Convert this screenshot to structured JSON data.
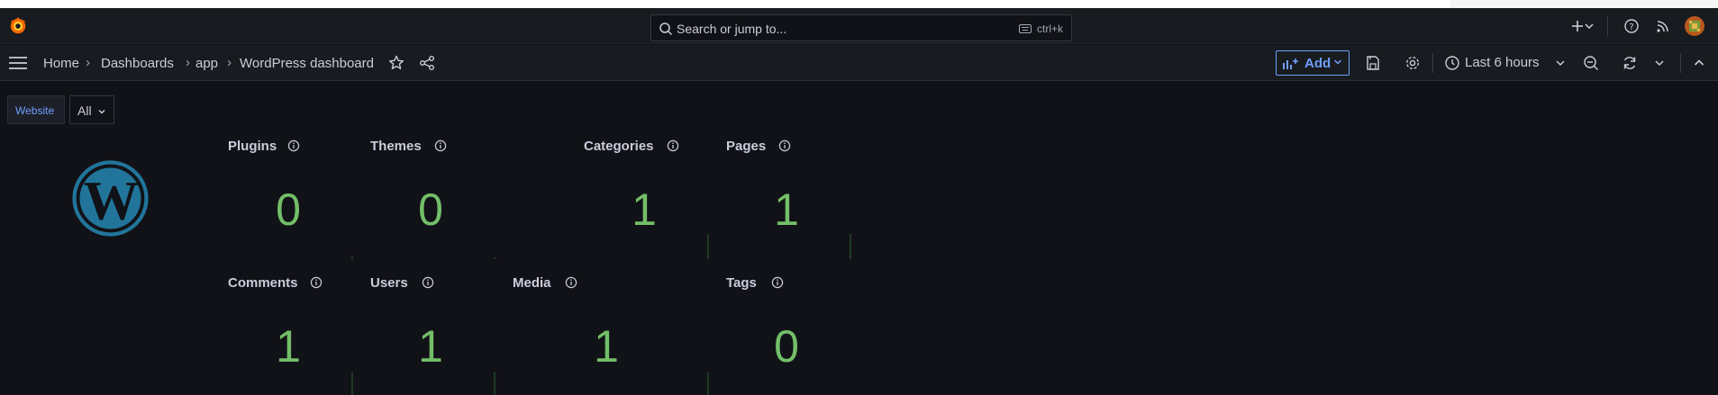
{
  "search": {
    "placeholder": "Search or jump to...",
    "shortcut": "ctrl+k"
  },
  "breadcrumb": [
    "Home",
    "Dashboards",
    "app",
    "WordPress dashboard"
  ],
  "breadcrumb_separator": "›",
  "toolbar": {
    "add_label": "Add",
    "time_range": "Last 6 hours"
  },
  "variables": {
    "label": "Website",
    "value": "All"
  },
  "panels": [
    {
      "title": "Plugins",
      "value": "0"
    },
    {
      "title": "Themes",
      "value": "0"
    },
    {
      "title": "Categories",
      "value": "1"
    },
    {
      "title": "Pages",
      "value": "1"
    },
    {
      "title": "Comments",
      "value": "1"
    },
    {
      "title": "Users",
      "value": "1"
    },
    {
      "title": "Media",
      "value": "1"
    },
    {
      "title": "Tags",
      "value": "0"
    }
  ],
  "colors": {
    "stat_green": "#73bf69",
    "accent_blue": "#6e9fff",
    "wordpress_blue": "#21759b",
    "grafana_orange": "#f46800"
  },
  "icons": [
    "grafana-logo-icon",
    "search-icon",
    "keyboard-icon",
    "plus-icon",
    "help-icon",
    "rss-icon",
    "avatar",
    "menu-icon",
    "star-icon",
    "share-icon",
    "add-panel-icon",
    "save-icon",
    "gear-icon",
    "clock-icon",
    "zoom-out-icon",
    "refresh-icon",
    "chevron-up-icon",
    "info-icon",
    "wordpress-logo-icon"
  ]
}
